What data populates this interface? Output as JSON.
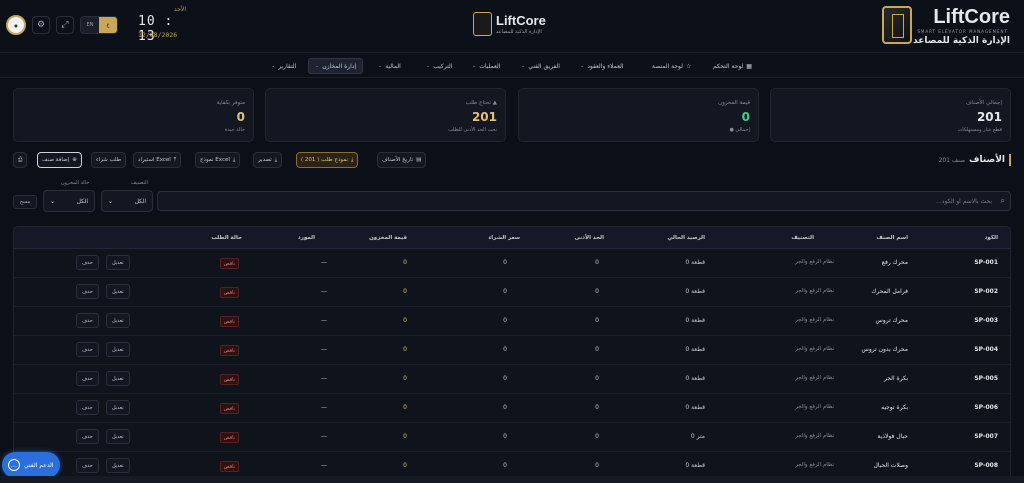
{
  "brand": {
    "name": "LiftCore",
    "tagline": "SMART ELEVATOR MANAGEMENT",
    "arabic_name": "الإدارة الذكية للمصاعد"
  },
  "brand_center": {
    "name": "LiftCore",
    "sub": "الإدارة الذكية للمصاعد"
  },
  "header": {
    "day": "الأحد",
    "time": "10 : 13",
    "time_suffix": "م",
    "date": "12/08/2026",
    "lang_active": "ع",
    "lang_inactive": "EN"
  },
  "nav": [
    {
      "label": "لوحة التحكم",
      "icon": "grid-icon"
    },
    {
      "label": "لوحة المنصة",
      "icon": "star-icon"
    },
    {
      "label": "العملاء والعقود",
      "chevron": true
    },
    {
      "label": "الفريق الفني",
      "chevron": true
    },
    {
      "label": "العمليات",
      "chevron": true
    },
    {
      "label": "التركيب",
      "chevron": true
    },
    {
      "label": "المالية",
      "chevron": true
    },
    {
      "label": "إدارة المخازن",
      "chevron": true,
      "active": true
    },
    {
      "label": "التقارير",
      "chevron": true
    }
  ],
  "cards": [
    {
      "label": "إجمالي الأصناف",
      "value": "201",
      "note": "قطع غيار ومستهلكات",
      "color": "#e5e7eb"
    },
    {
      "label": "قيمة المخزون",
      "value": "0",
      "note": "● إجمالي",
      "color": "#3ecf8e"
    },
    {
      "label": "تحتاج طلب ▲",
      "value": "201",
      "note": "تحت الحد الأدنى للطلب",
      "color": "#e3c173"
    },
    {
      "label": "متوفر بكفاية",
      "value": "0",
      "note": "حالة جيدة",
      "color": "#e3c173"
    }
  ],
  "page": {
    "title": "الأصناف",
    "count": "201 صنف"
  },
  "toolbar": {
    "categories": "تاريخ الأصناف",
    "reorder": "نموذج طلب ( 201 )",
    "export": "تصدير",
    "template": "نموذج Excel",
    "import": "استيراد Excel",
    "request": "طلب شراء",
    "add": "إضافة صنف",
    "print": "⎙"
  },
  "filters": {
    "category_label": "التصنيف",
    "category_value": "الكل",
    "status_label": "حالة المخزون",
    "status_value": "الكل",
    "search_placeholder": "بحث بالاسم أو الكود...",
    "clear": "مسح"
  },
  "table": {
    "headers": [
      "الكود",
      "اسم الصنف",
      "التصنيف",
      "الرصيد الحالي",
      "الحد الأدنى",
      "سعر الشراء",
      "قيمة المخزون",
      "المورد",
      "حالة الطلب"
    ],
    "edit_label": "تعديل",
    "delete_label": "حذف",
    "rows": [
      {
        "code": "SP-001",
        "name": "محرك رفع",
        "category": "نظام الرفع والجر",
        "balance": "0 قطعة",
        "min": "0",
        "price": "0",
        "value": "0",
        "supplier": "—",
        "status": "ناقص"
      },
      {
        "code": "SP-002",
        "name": "فرامل المحرك",
        "category": "نظام الرفع والجر",
        "balance": "0 قطعة",
        "min": "0",
        "price": "0",
        "value": "0",
        "supplier": "—",
        "status": "ناقص"
      },
      {
        "code": "SP-003",
        "name": "محرك تروس",
        "category": "نظام الرفع والجر",
        "balance": "0 قطعة",
        "min": "0",
        "price": "0",
        "value": "0",
        "supplier": "—",
        "status": "ناقص"
      },
      {
        "code": "SP-004",
        "name": "محرك بدون تروس",
        "category": "نظام الرفع والجر",
        "balance": "0 قطعة",
        "min": "0",
        "price": "0",
        "value": "0",
        "supplier": "—",
        "status": "ناقص"
      },
      {
        "code": "SP-005",
        "name": "بكرة الجر",
        "category": "نظام الرفع والجر",
        "balance": "0 قطعة",
        "min": "0",
        "price": "0",
        "value": "0",
        "supplier": "—",
        "status": "ناقص"
      },
      {
        "code": "SP-006",
        "name": "بكرة توجيه",
        "category": "نظام الرفع والجر",
        "balance": "0 قطعة",
        "min": "0",
        "price": "0",
        "value": "0",
        "supplier": "—",
        "status": "ناقص"
      },
      {
        "code": "SP-007",
        "name": "حبال فولاذية",
        "category": "نظام الرفع والجر",
        "balance": "0 متر",
        "min": "0",
        "price": "0",
        "value": "0",
        "supplier": "—",
        "status": "ناقص"
      },
      {
        "code": "SP-008",
        "name": "وصلات الحبال",
        "category": "نظام الرفع والجر",
        "balance": "0 قطعة",
        "min": "0",
        "price": "0",
        "value": "0",
        "supplier": "—",
        "status": "ناقص"
      }
    ]
  },
  "support": {
    "label": "الدعم الفني"
  },
  "colors": {
    "accent": "#c9a75a",
    "danger": "#ef6b6b",
    "success": "#3ecf8e",
    "support": "#2a6fdb"
  }
}
